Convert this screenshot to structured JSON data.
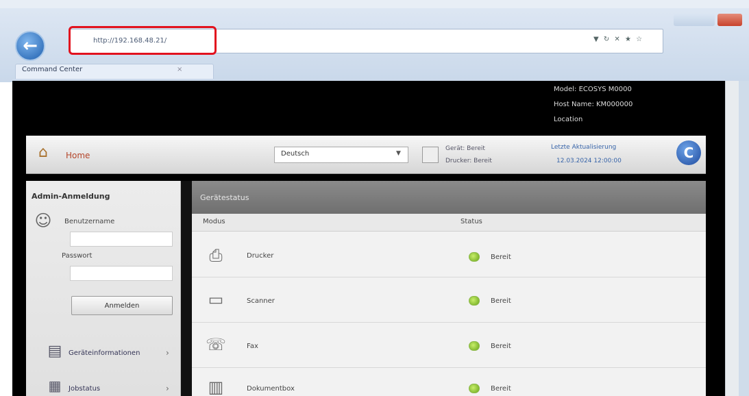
{
  "browser": {
    "address": "http://192.168.48.21/",
    "tab_label": "Command Center",
    "tab_close": "×",
    "addr_tools": "▼ ↻ ✕ ★ ☆",
    "back_glyph": "←"
  },
  "header": {
    "line1": "Model: ECOSYS M0000",
    "line2": "Host Name: KM000000",
    "line3": "Location"
  },
  "navbar": {
    "home_label": "Home",
    "language": "Deutsch",
    "status_line1": "Gerät: Bereit",
    "status_line2": "Drucker: Bereit",
    "link1": "Letzte Aktualisierung",
    "link2": "12.03.2024 12:00:00",
    "refresh_glyph": "C",
    "accent_color": "#b4452a"
  },
  "login": {
    "title": "Admin-Anmeldung",
    "username_label": "Benutzername",
    "password_label": "Passwort",
    "login_button": "Anmelden",
    "device_link": "Geräteinformationen",
    "job_link": "Jobstatus",
    "arrow": "›"
  },
  "status_panel": {
    "title": "Gerätestatus",
    "col_mode": "Modus",
    "col_status": "Status",
    "rows": [
      {
        "label": "Drucker",
        "status": "Bereit",
        "icon": "printer-icon"
      },
      {
        "label": "Scanner",
        "status": "Bereit",
        "icon": "scanner-icon"
      },
      {
        "label": "Fax",
        "status": "Bereit",
        "icon": "fax-icon"
      },
      {
        "label": "Dokumentbox",
        "status": "Bereit",
        "icon": "document-box-icon"
      }
    ]
  }
}
